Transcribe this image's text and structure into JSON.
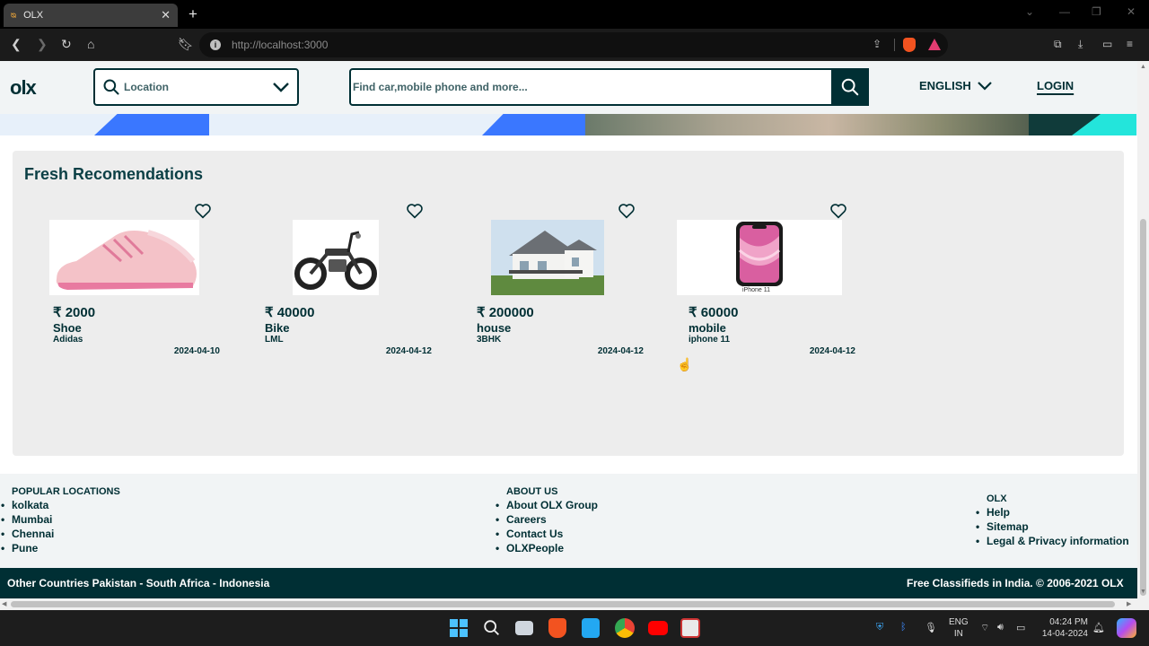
{
  "browser": {
    "tab_title": "OLX",
    "url": "http://localhost:3000",
    "new_tab": "+",
    "tab_close": "✕"
  },
  "header": {
    "logo": "olx",
    "location_placeholder": "Location",
    "search_placeholder": "Find car,mobile phone and more...",
    "language": "ENGLISH",
    "login": "LOGIN"
  },
  "fresh": {
    "title": "Fresh Recomendations",
    "cards": [
      {
        "price": "₹ 2000",
        "name": "Shoe",
        "desc": "Adidas",
        "date": "2024-04-10",
        "image": "shoe"
      },
      {
        "price": "₹ 40000",
        "name": "Bike",
        "desc": "LML",
        "date": "2024-04-12",
        "image": "bike"
      },
      {
        "price": "₹ 200000",
        "name": "house",
        "desc": "3BHK",
        "date": "2024-04-12",
        "image": "house"
      },
      {
        "price": "₹ 60000",
        "name": "mobile",
        "desc": "iphone 11",
        "date": "2024-04-12",
        "image": "iphone",
        "image_caption": "iPhone 11"
      }
    ]
  },
  "footer": {
    "popular": {
      "heading": "POPULAR LOCATIONS",
      "items": [
        "kolkata",
        "Mumbai",
        "Chennai",
        "Pune"
      ]
    },
    "about": {
      "heading": "ABOUT US",
      "items": [
        "About OLX Group",
        "Careers",
        "Contact Us",
        "OLXPeople"
      ]
    },
    "olx": {
      "heading": "OLX",
      "items": [
        "Help",
        "Sitemap",
        "Legal & Privacy information"
      ]
    },
    "bottom_left": "Other Countries Pakistan - South Africa - Indonesia",
    "bottom_right": "Free Classifieds in India. © 2006-2021 OLX"
  },
  "taskbar": {
    "lang_line1": "ENG",
    "lang_line2": "IN",
    "time": "04:24 PM",
    "date": "14-04-2024"
  },
  "colors": {
    "brand_dark": "#002f34",
    "banner_blue": "#3a77ff",
    "section_bg": "#ededed"
  }
}
